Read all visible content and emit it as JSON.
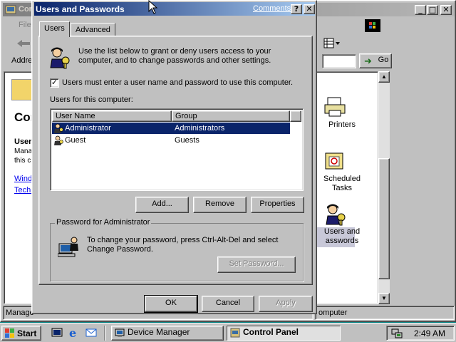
{
  "control_panel": {
    "title": "Con",
    "menu_file": "File",
    "address_label": "Addre",
    "go_label": "Go",
    "leftpane_title": "Con",
    "leftpane_heading": "User",
    "leftpane_desc1": "Mana",
    "leftpane_desc2": "this c",
    "link1": "Windo",
    "link2": "Techn",
    "icons": [
      {
        "label": "Printers",
        "icon": "printer-icon"
      },
      {
        "label": "Scheduled Tasks",
        "icon": "scheduled-tasks-icon"
      },
      {
        "label": "Users and Passwords",
        "icon": "users-passwords-icon"
      }
    ],
    "icon_label_lines": {
      "printers": "Printers",
      "scheduled_1": "Scheduled",
      "scheduled_2": "Tasks",
      "users_1": "Users and",
      "users_2": "asswords"
    },
    "status_left": "Manage",
    "status_right": "omputer"
  },
  "dialog": {
    "title": "Users and Passwords",
    "comments_link": "Comments?",
    "help_glyph": "?",
    "close_glyph": "✕",
    "tabs": [
      {
        "label": "Users",
        "active": true
      },
      {
        "label": "Advanced",
        "active": false
      }
    ],
    "intro_line1": "Use the list below to grant or deny users access to your",
    "intro_line2": "computer, and to change passwords and other settings.",
    "require_login_checked": true,
    "require_login_label": "Users must enter a user name and password to use this computer.",
    "users_list_label": "Users for this computer:",
    "columns": [
      "User Name",
      "Group"
    ],
    "users": [
      {
        "name": "Administrator",
        "group": "Administrators",
        "selected": true
      },
      {
        "name": "Guest",
        "group": "Guests",
        "selected": false
      }
    ],
    "buttons": {
      "add": "Add...",
      "remove": "Remove",
      "properties": "Properties",
      "set_password": "Set Password...",
      "ok": "OK",
      "cancel": "Cancel",
      "apply": "Apply"
    },
    "password_group_label": "Password for Administrator",
    "password_text1": "To change your password, press Ctrl-Alt-Del and select",
    "password_text2": "Change Password."
  },
  "taskbar": {
    "start_label": "Start",
    "tasks": [
      {
        "label": "Device Manager",
        "active": false
      },
      {
        "label": "Control Panel",
        "active": true
      }
    ],
    "clock": "2:49 AM"
  },
  "colors": {
    "desktop": "#008080",
    "active_title": "#0a246a",
    "selection": "#0a246a",
    "face": "#c0c0c0"
  }
}
